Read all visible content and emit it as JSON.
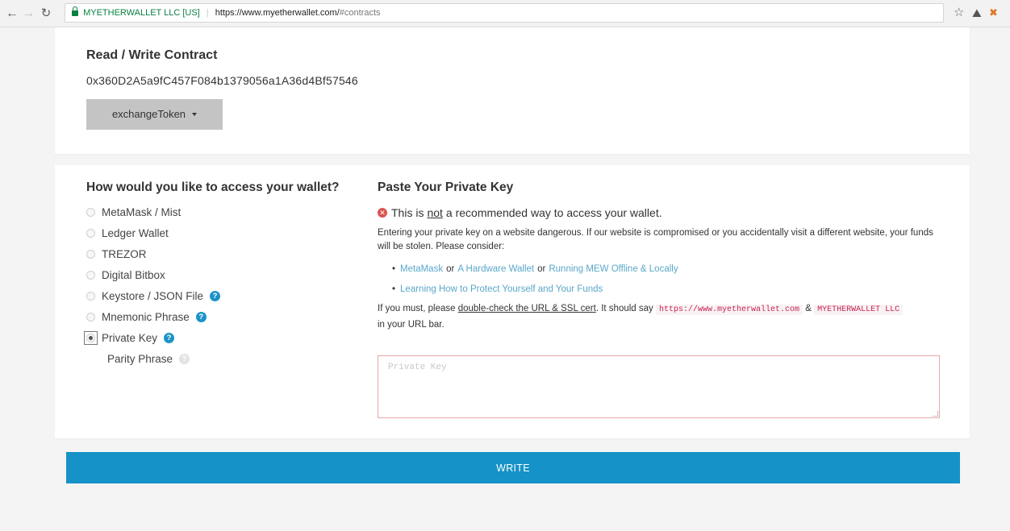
{
  "browser": {
    "cert_name": "MYETHERWALLET LLC [US]",
    "url_host": "https://www.myetherwallet.com/",
    "url_path": "#contracts"
  },
  "contract": {
    "title": "Read / Write Contract",
    "address": "0x360D2A5a9fC457F084b1379056a1A36d4Bf57546",
    "function_selected": "exchangeToken"
  },
  "access": {
    "title": "How would you like to access your wallet?",
    "options": [
      {
        "label": "MetaMask / Mist",
        "help": false,
        "selected": false
      },
      {
        "label": "Ledger Wallet",
        "help": false,
        "selected": false
      },
      {
        "label": "TREZOR",
        "help": false,
        "selected": false
      },
      {
        "label": "Digital Bitbox",
        "help": false,
        "selected": false
      },
      {
        "label": "Keystore / JSON File",
        "help": true,
        "selected": false
      },
      {
        "label": "Mnemonic Phrase",
        "help": true,
        "selected": false
      },
      {
        "label": "Private Key",
        "help": true,
        "selected": true
      }
    ],
    "sub_option": "Parity Phrase"
  },
  "private_key": {
    "title": "Paste Your Private Key",
    "warning_pre": "This is ",
    "warning_not": "not",
    "warning_post": " a recommended way to access your wallet.",
    "body": "Entering your private key on a website dangerous. If our website is compromised or you accidentally visit a different website, your funds will be stolen. Please consider:",
    "link_metamask": "MetaMask",
    "or_1": "or",
    "link_hardware": "A Hardware Wallet",
    "or_2": "or",
    "link_offline": "Running MEW Offline & Locally",
    "link_learn": "Learning How to Protect Yourself and Your Funds",
    "ssl_pre": "If you must, please ",
    "ssl_link": "double-check the URL & SSL cert",
    "ssl_mid": ". It should say ",
    "ssl_code_url": "https://www.myetherwallet.com",
    "ssl_amp": " & ",
    "ssl_code_llc": "MYETHERWALLET LLC",
    "ssl_post": " in your URL bar.",
    "placeholder": "Private Key"
  },
  "write_button": "WRITE",
  "colors": {
    "accent": "#1592c7",
    "link": "#5aa7c9",
    "error": "#d9534f",
    "secure_green": "#0b8043"
  }
}
